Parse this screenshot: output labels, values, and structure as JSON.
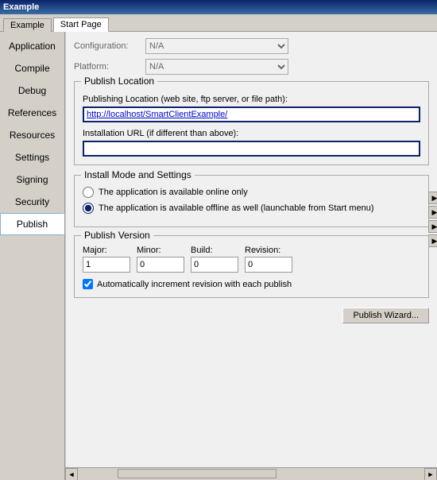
{
  "titleBar": {
    "text": "Example"
  },
  "tabs": [
    {
      "label": "Example",
      "active": false
    },
    {
      "label": "Start Page",
      "active": true
    }
  ],
  "sidebar": {
    "items": [
      {
        "id": "application",
        "label": "Application"
      },
      {
        "id": "compile",
        "label": "Compile"
      },
      {
        "id": "debug",
        "label": "Debug"
      },
      {
        "id": "references",
        "label": "References"
      },
      {
        "id": "resources",
        "label": "Resources"
      },
      {
        "id": "settings",
        "label": "Settings"
      },
      {
        "id": "signing",
        "label": "Signing"
      },
      {
        "id": "security",
        "label": "Security"
      },
      {
        "id": "publish",
        "label": "Publish"
      }
    ],
    "activeItem": "publish"
  },
  "content": {
    "configuration": {
      "label": "Configuration:",
      "value": "N/A"
    },
    "platform": {
      "label": "Platform:",
      "value": "N/A"
    },
    "publishLocation": {
      "sectionTitle": "Publish Location",
      "publishingLabel": "Publishing Location (web site, ftp server, or file path):",
      "publishingValue": "http://localhost/SmartClientExample/",
      "installUrlLabel": "Installation URL (if different than above):",
      "installUrlValue": ""
    },
    "installMode": {
      "sectionTitle": "Install Mode and Settings",
      "options": [
        {
          "id": "online-only",
          "label": "The application is available online only",
          "checked": false
        },
        {
          "id": "offline-also",
          "label": "The application is available offline as well (launchable from Start menu)",
          "checked": true
        }
      ]
    },
    "publishVersion": {
      "sectionTitle": "Publish Version",
      "fields": [
        {
          "id": "major",
          "label": "Major:",
          "value": "1"
        },
        {
          "id": "minor",
          "label": "Minor:",
          "value": "0"
        },
        {
          "id": "build",
          "label": "Build:",
          "value": "0"
        },
        {
          "id": "revision",
          "label": "Revision:",
          "value": "0"
        }
      ],
      "autoIncrementLabel": "Automatically increment revision with each publish",
      "autoIncrementChecked": true
    },
    "publishWizardButton": "Publish Wizard..."
  },
  "scrollbar": {
    "leftArrow": "◄",
    "rightArrow": "►"
  }
}
